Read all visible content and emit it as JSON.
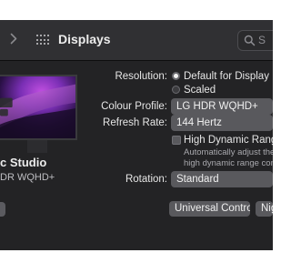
{
  "window": {
    "title": "Displays",
    "search": {
      "placeholder": "S"
    }
  },
  "icons": {
    "forward": "chevron-right-icon",
    "grid": "grid-icon",
    "search": "magnifying-glass-icon"
  },
  "display": {
    "name": "c Studio",
    "model": "DR WQHD+"
  },
  "settings": {
    "resolution": {
      "label": "Resolution:",
      "options": [
        {
          "label": "Default for Display",
          "selected": true
        },
        {
          "label": "Scaled",
          "selected": false
        }
      ]
    },
    "colour_profile": {
      "label": "Colour Profile:",
      "value": "LG HDR WQHD+"
    },
    "refresh_rate": {
      "label": "Refresh Rate:",
      "value": "144 Hertz"
    },
    "hdr": {
      "label": "High Dynamic Range",
      "checked": false,
      "note_line1": "Automatically adjust the dis",
      "note_line2": "high dynamic range conten"
    },
    "rotation": {
      "label": "Rotation:",
      "value": "Standard"
    }
  },
  "buttons": {
    "universal_control": "Universal Control...",
    "night_shift": "Nig"
  },
  "colors": {
    "window_bg": "#232325",
    "toolbar_bg": "#303033",
    "control_bg": "#59595d",
    "text": "#e6e6e6"
  }
}
